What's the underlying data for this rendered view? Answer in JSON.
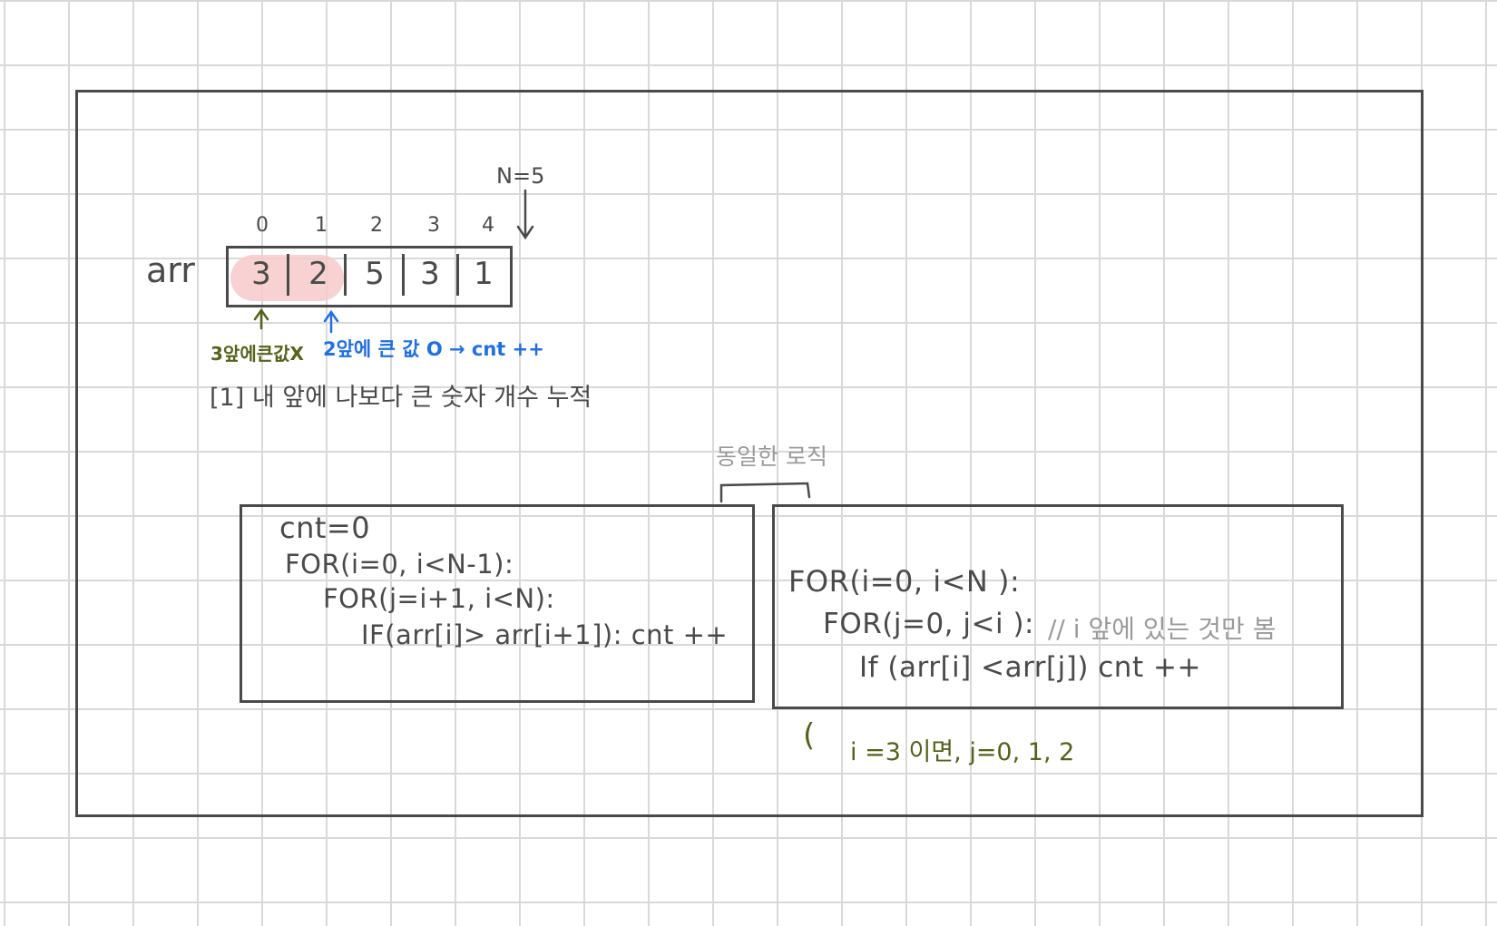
{
  "sketch": {
    "array_label": "arr",
    "n_label": "N=5",
    "indices": [
      "0",
      "1",
      "2",
      "3",
      "4"
    ],
    "cells": [
      "3",
      "2",
      "5",
      "3",
      "1"
    ],
    "note_first": "3앞에큰값X",
    "note_second": "2앞에 큰 값 O → cnt ++",
    "title": "[1] 내 앞에 나보다 큰 숫자 개수 누적",
    "same_logic_label": "동일한 로직",
    "left_code": [
      "cnt=0",
      "FOR(i=0, i<N-1):",
      "FOR(j=i+1, i<N):",
      "IF(arr[i]> arr[i+1]): cnt ++"
    ],
    "right_code": [
      "FOR(i=0, i<N ):",
      "FOR(j=0, j<i ):",
      "// i 앞에 있는 것만 봄",
      "If (arr[i] <arr[j])  cnt ++"
    ],
    "footnote_paren": "(",
    "footnote": "i =3 이면, j=0, 1, 2"
  },
  "colors": {
    "ink": "#4a4a4a",
    "olive": "#55621a",
    "blue": "#1f6fe6",
    "gray": "#9a9a9a",
    "highlight": "#f7caca"
  }
}
